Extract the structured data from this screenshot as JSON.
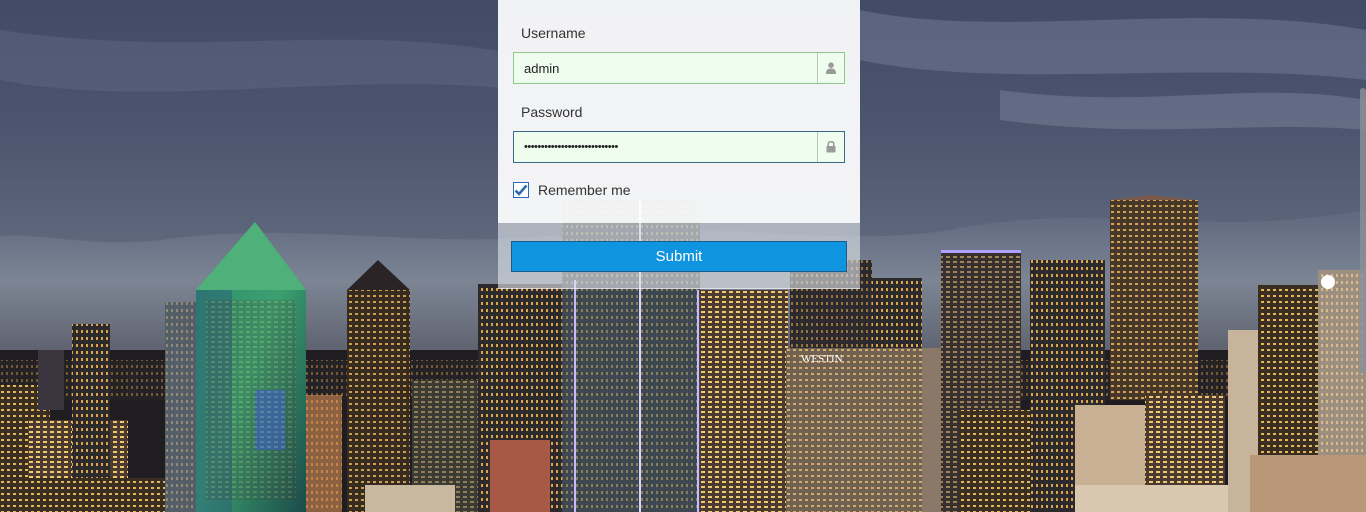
{
  "login_form": {
    "username_label": "Username",
    "username_value": "admin",
    "password_label": "Password",
    "password_value": "••••••••••••••••••••••••••••",
    "remember_label": "Remember me",
    "remember_checked": true,
    "submit_label": "Submit"
  },
  "background": {
    "signs": [
      "WESTIN"
    ]
  },
  "icons": {
    "username_addon": "user-icon",
    "password_addon": "lock-icon",
    "checkbox_mark": "check-icon"
  },
  "colors": {
    "submit_button": "#0f95e0",
    "field_background": "#effdee",
    "field_border": "#8cc98a",
    "checkbox_border": "#2b6cb0"
  }
}
